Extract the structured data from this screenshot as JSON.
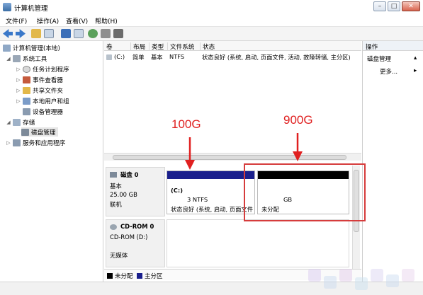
{
  "window": {
    "title": "计算机管理",
    "controls": [
      "–",
      "□",
      "✕"
    ]
  },
  "menu": [
    "文件(F)",
    "操作(A)",
    "查看(V)",
    "帮助(H)"
  ],
  "tree": {
    "root": "计算机管理(本地)",
    "system_tools": "系统工具",
    "task_scheduler": "任务计划程序",
    "event_viewer": "事件查看器",
    "shared_folders": "共享文件夹",
    "local_users": "本地用户和组",
    "device_manager": "设备管理器",
    "storage": "存储",
    "disk_management": "磁盘管理",
    "services": "服务和应用程序"
  },
  "volume_table": {
    "columns": [
      "卷",
      "布局",
      "类型",
      "文件系统",
      "状态"
    ],
    "row": {
      "volume": "(C:)",
      "layout": "简单",
      "type": "基本",
      "fs": "NTFS",
      "status": "状态良好 (系统, 启动, 页面文件, 活动, 故障转储, 主分区)"
    }
  },
  "disk0": {
    "name": "磁盘 0",
    "type": "基本",
    "size": "25.00 GB",
    "state": "联机",
    "partitions": [
      {
        "label": "(C:)",
        "size": "3 NTFS",
        "status": "状态良好 (系统, 启动, 页面文件",
        "bar_color": "#1a1f8c"
      },
      {
        "label": "",
        "size": "GB",
        "status": "未分配",
        "bar_color": "#000000"
      }
    ]
  },
  "cdrom": {
    "name": "CD-ROM 0",
    "drive": "CD-ROM (D:)",
    "media": "无媒体"
  },
  "legend": {
    "unallocated": "未分配",
    "primary": "主分区",
    "unallocated_color": "#000000",
    "primary_color": "#1a1f8c"
  },
  "actions": {
    "header": "操作",
    "section": "磁盘管理",
    "more": "更多..."
  },
  "annotations": {
    "label_100g": "100G",
    "label_900g": "900G",
    "color": "#e02020"
  }
}
